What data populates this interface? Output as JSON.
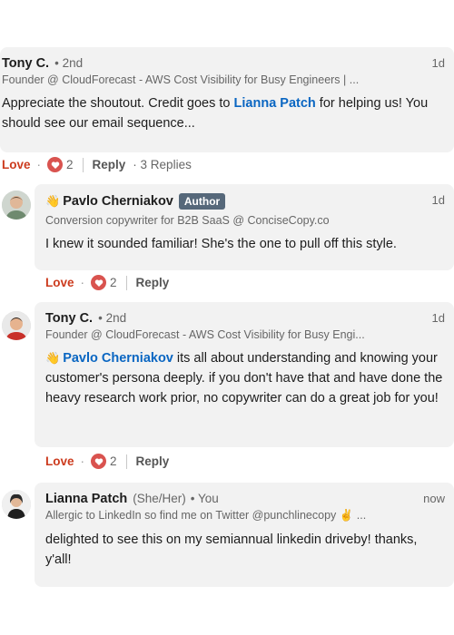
{
  "top_comment": {
    "author": "Tony C.",
    "degree": "• 2nd",
    "time": "1d",
    "headline": "Founder @ CloudForecast - AWS Cost Visibility for Busy Engineers | ...",
    "text_before": "Appreciate the shoutout. Credit goes to ",
    "mention": "Lianna Patch",
    "text_after": " for helping us! You should see our email sequence...",
    "actions": {
      "love": "Love",
      "sep": "·",
      "count": "2",
      "reply": "Reply",
      "replies": "· 3 Replies"
    }
  },
  "replies": [
    {
      "author": "Pavlo Cherniakov",
      "badge": "Author",
      "time": "1d",
      "headline": "Conversion copywriter for B2B SaaS @ ConciseCopy.co",
      "text": "I knew it sounded familiar! She's the one to pull off this style.",
      "actions": {
        "love": "Love",
        "sep": "·",
        "count": "2",
        "reply": "Reply"
      }
    },
    {
      "author": "Tony C.",
      "degree": "• 2nd",
      "time": "1d",
      "headline": "Founder @ CloudForecast - AWS Cost Visibility for Busy Engi...",
      "mention": "Pavlo Cherniakov",
      "text": " its all about understanding and knowing your customer's persona deeply. if you don't have that and have done the heavy research work prior, no copywriter can do a great job for you!",
      "actions": {
        "love": "Love",
        "sep": "·",
        "count": "2",
        "reply": "Reply"
      }
    },
    {
      "author": "Lianna Patch",
      "pronouns": "(She/Her)",
      "you": "• You",
      "time": "now",
      "headline": "Allergic to LinkedIn so find me on Twitter @punchlinecopy ✌️ ...",
      "text": "delighted to see this on my semiannual linkedin driveby! thanks, y'all!"
    }
  ],
  "colors": {
    "mention": "#0a66c2",
    "love": "#cc3b1e",
    "badge": "#56687a"
  }
}
